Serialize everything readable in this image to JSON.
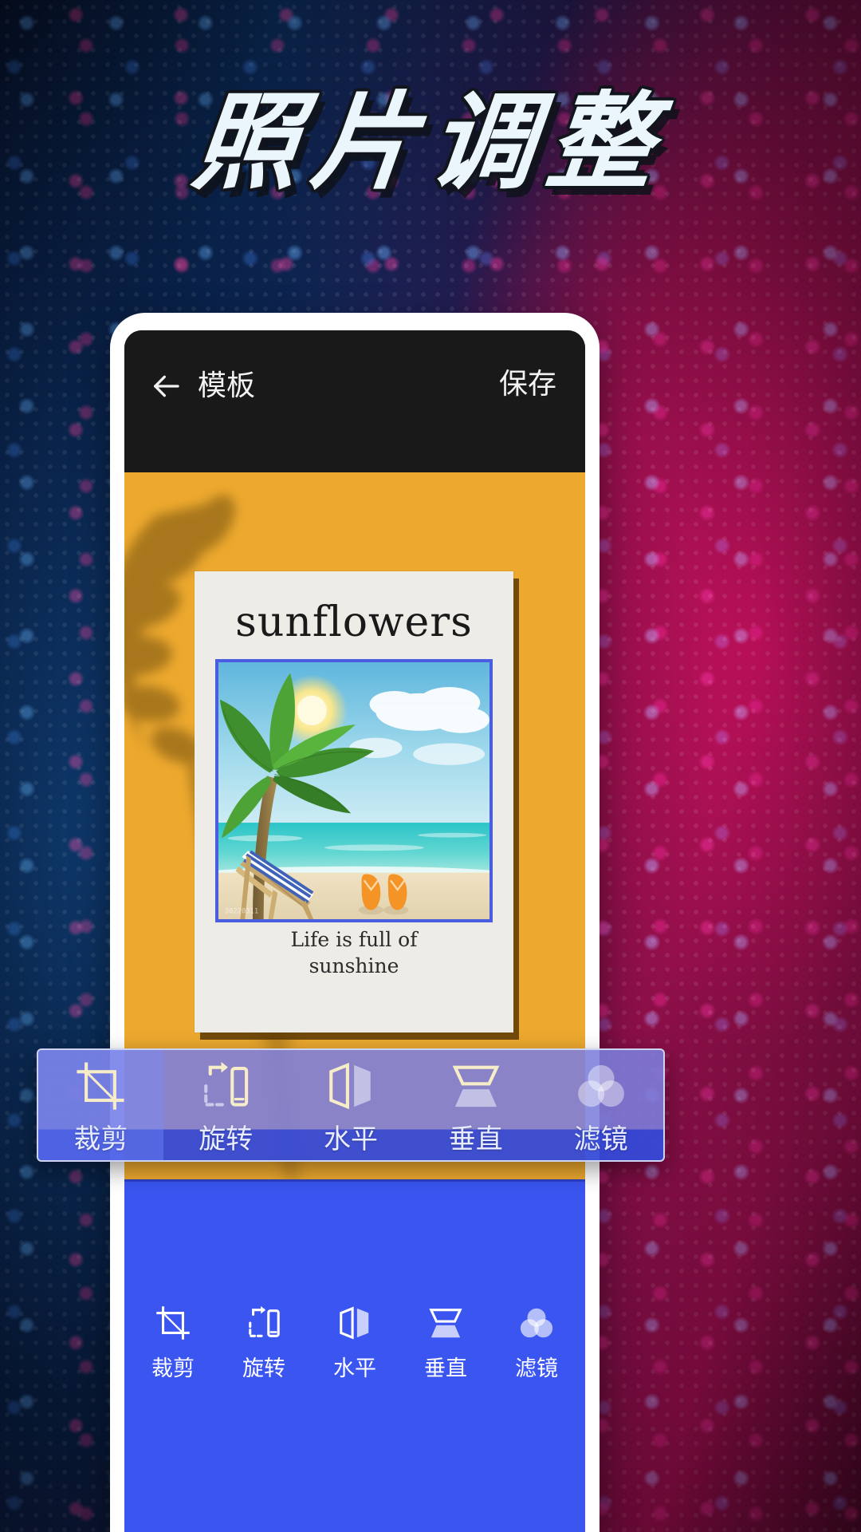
{
  "promo": {
    "headline": "照片调整"
  },
  "colors": {
    "accent_blue": "#3a55f0",
    "callout_blue": "#3449d8",
    "canvas_orange": "#eda92e",
    "appbar_dark": "#191919",
    "photo_frame": "#4a5ce0",
    "icon_cream": "#f4e6c0",
    "label_white": "#ffffff"
  },
  "appbar": {
    "back_icon": "arrow-left-icon",
    "title": "模板",
    "save_label": "保存"
  },
  "poster": {
    "title": "sunflowers",
    "caption": "Life is full of\nsunshine",
    "caption_line1": "Life is full of",
    "caption_line2": "sunshine",
    "photo_watermark": "30220311"
  },
  "toolbar": {
    "items": [
      {
        "label": "裁剪",
        "icon": "crop-icon",
        "selected": true
      },
      {
        "label": "旋转",
        "icon": "rotate-icon",
        "selected": false
      },
      {
        "label": "水平",
        "icon": "flip-horizontal-icon",
        "selected": false
      },
      {
        "label": "垂直",
        "icon": "flip-vertical-icon",
        "selected": false
      },
      {
        "label": "滤镜",
        "icon": "filter-circles-icon",
        "selected": false
      }
    ]
  },
  "callout": {
    "items": [
      {
        "label": "裁剪",
        "icon": "crop-icon"
      },
      {
        "label": "旋转",
        "icon": "rotate-icon"
      },
      {
        "label": "水平",
        "icon": "flip-horizontal-icon"
      },
      {
        "label": "垂直",
        "icon": "flip-vertical-icon"
      },
      {
        "label": "滤镜",
        "icon": "filter-circles-icon"
      }
    ]
  }
}
